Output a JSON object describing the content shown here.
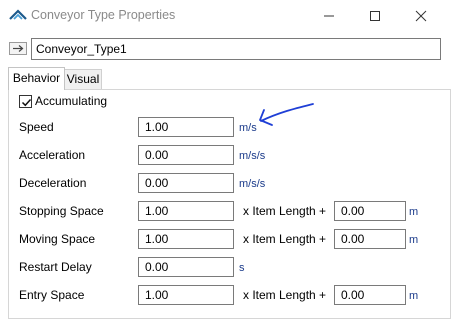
{
  "window": {
    "title": "Conveyor Type Properties",
    "controls": [
      "minimize",
      "maximize",
      "close"
    ]
  },
  "object": {
    "name": "Conveyor_Type1"
  },
  "tabs": [
    {
      "label": "Behavior",
      "active": true
    },
    {
      "label": "Visual",
      "active": false
    }
  ],
  "accumulating": {
    "label": "Accumulating",
    "checked": true
  },
  "props": {
    "speed": {
      "label": "Speed",
      "value": "1.00",
      "unit": "m/s"
    },
    "acceleration": {
      "label": "Acceleration",
      "value": "0.00",
      "unit": "m/s/s"
    },
    "deceleration": {
      "label": "Deceleration",
      "value": "0.00",
      "unit": "m/s/s"
    },
    "stopping_space": {
      "label": "Stopping Space",
      "value": "1.00",
      "times_label": "x  Item Length",
      "plus": "+",
      "offset": "0.00",
      "unit": "m"
    },
    "moving_space": {
      "label": "Moving Space",
      "value": "1.00",
      "times_label": "x  Item Length",
      "plus": "+",
      "offset": "0.00",
      "unit": "m"
    },
    "restart_delay": {
      "label": "Restart Delay",
      "value": "0.00",
      "unit": "s"
    },
    "entry_space": {
      "label": "Entry Space",
      "value": "1.00",
      "times_label": "x  Item Length",
      "plus": "+",
      "offset": "0.00",
      "unit": "m"
    }
  },
  "annotation": {
    "color": "#1f3fd6"
  },
  "colors": {
    "unit_text": "#1a3a8a",
    "title_text": "#8a8a8a"
  }
}
